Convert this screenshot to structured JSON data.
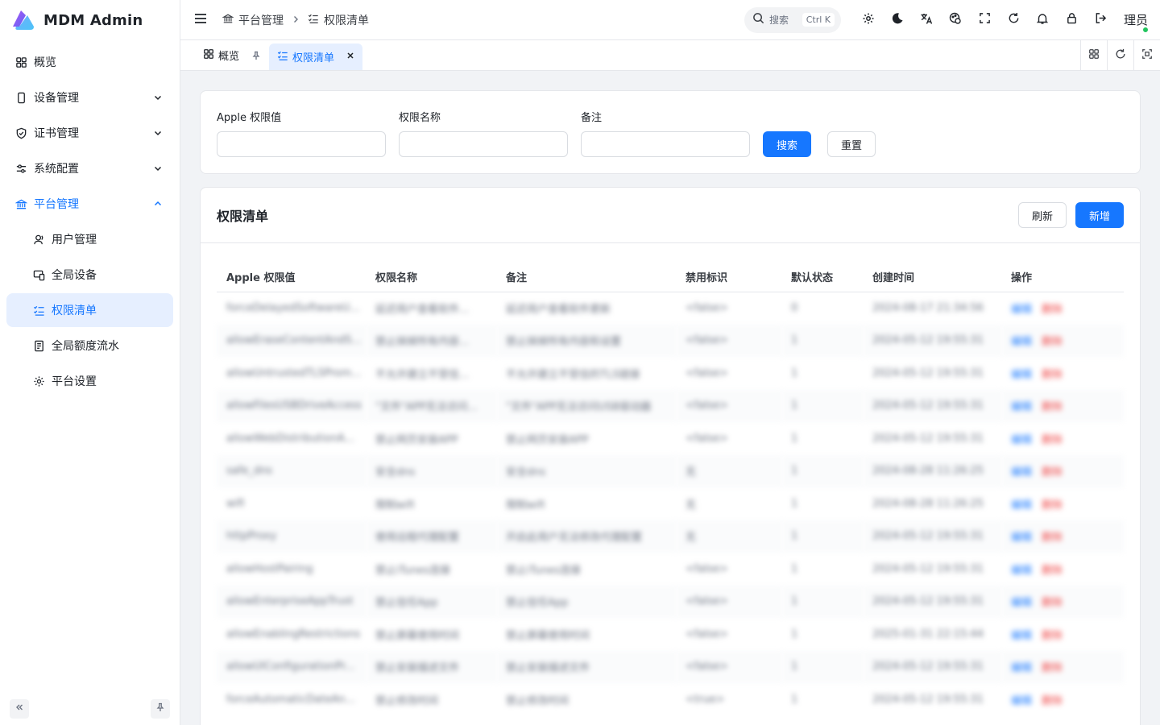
{
  "app": {
    "title": "MDM Admin"
  },
  "sidebar": {
    "items": [
      {
        "label": "概览",
        "icon": "dashboard-icon"
      },
      {
        "label": "设备管理",
        "icon": "phone-icon"
      },
      {
        "label": "证书管理",
        "icon": "shield-icon"
      },
      {
        "label": "系统配置",
        "icon": "sliders-icon"
      },
      {
        "label": "平台管理",
        "icon": "bank-icon"
      }
    ],
    "sub_items": [
      {
        "label": "用户管理",
        "icon": "user-icon"
      },
      {
        "label": "全局设备",
        "icon": "devices-icon"
      },
      {
        "label": "权限清单",
        "icon": "checklist-icon"
      },
      {
        "label": "全局额度流水",
        "icon": "ledger-icon"
      },
      {
        "label": "平台设置",
        "icon": "gear-icon"
      }
    ]
  },
  "header": {
    "breadcrumb": [
      "平台管理",
      "权限清单"
    ],
    "search_placeholder": "搜索",
    "search_shortcut": "Ctrl K",
    "user_name": "理员"
  },
  "tabs": [
    {
      "label": "概览"
    },
    {
      "label": "权限清单"
    }
  ],
  "filter": {
    "fields": [
      {
        "label": "Apple 权限值",
        "value": ""
      },
      {
        "label": "权限名称",
        "value": ""
      },
      {
        "label": "备注",
        "value": ""
      }
    ],
    "search_label": "搜索",
    "reset_label": "重置"
  },
  "list": {
    "title": "权限清单",
    "refresh_label": "刷新",
    "add_label": "新增",
    "columns": [
      "Apple 权限值",
      "权限名称",
      "备注",
      "禁用标识",
      "默认状态",
      "创建时间",
      "操作"
    ],
    "rows": [
      [
        "forceDelayedSoftwareU...",
        "延迟用户查看软件...",
        "延迟用户查看软件更新",
        "<false>",
        "0",
        "2024-08-17 21:34:56",
        "编辑",
        "删除"
      ],
      [
        "allowEraseContentAndS...",
        "禁止抹掉所有内容...",
        "禁止抹掉所有内容和设置",
        "<false>",
        "1",
        "2024-05-12 19:55:31",
        "编辑",
        "删除"
      ],
      [
        "allowUntrustedTLSProm...",
        "不允许建立不受信...",
        "不允许建立不受信的TLS链接",
        "<false>",
        "1",
        "2024-05-12 19:55:31",
        "编辑",
        "删除"
      ],
      [
        "allowFilesUSBDriveAccess",
        "\"文件\"APP无法访问...",
        "\"文件\"APP无法访问USB驱动器",
        "<false>",
        "1",
        "2024-05-12 19:55:31",
        "编辑",
        "删除"
      ],
      [
        "allowWebDistributionA...",
        "禁止网页安装APP",
        "禁止网页安装APP",
        "<false>",
        "1",
        "2024-05-12 19:55:31",
        "编辑",
        "删除"
      ],
      [
        "safe_dns",
        "安全dns",
        "安全dns",
        "无",
        "1",
        "2024-08-28 11:26:25",
        "编辑",
        "删除"
      ],
      [
        "wifi",
        "限制wifi",
        "限制wifi",
        "无",
        "1",
        "2024-08-28 11:26:25",
        "编辑",
        "删除"
      ],
      [
        "httpProxy",
        "使用远程代理配置",
        "开启此用户无法修改代理配置",
        "无",
        "1",
        "2024-05-12 19:55:31",
        "编辑",
        "删除"
      ],
      [
        "allowHostPairing",
        "禁止iTunes连接",
        "禁止iTunes连接",
        "<false>",
        "1",
        "2024-05-12 19:55:31",
        "编辑",
        "删除"
      ],
      [
        "allowEnterpriseAppTrust",
        "禁止信任App",
        "禁止信任App",
        "<false>",
        "1",
        "2024-05-12 19:55:31",
        "编辑",
        "删除"
      ],
      [
        "allowEnablingRestrictions",
        "禁止屏幕使用时间",
        "禁止屏幕使用时间",
        "<false>",
        "1",
        "2025-01-31 22:15:44",
        "编辑",
        "删除"
      ],
      [
        "allowUIConfigurationPr...",
        "禁止安装描述文件",
        "禁止安装描述文件",
        "<false>",
        "1",
        "2024-05-12 19:55:31",
        "编辑",
        "删除"
      ],
      [
        "forceAutomaticDateAn...",
        "禁止修改时间",
        "禁止修改时间",
        "<true>",
        "1",
        "2024-05-12 19:55:31",
        "编辑",
        "删除"
      ]
    ]
  },
  "colors": {
    "primary": "#1677ff",
    "danger": "#ef4444",
    "active_bg": "#e6efff"
  }
}
